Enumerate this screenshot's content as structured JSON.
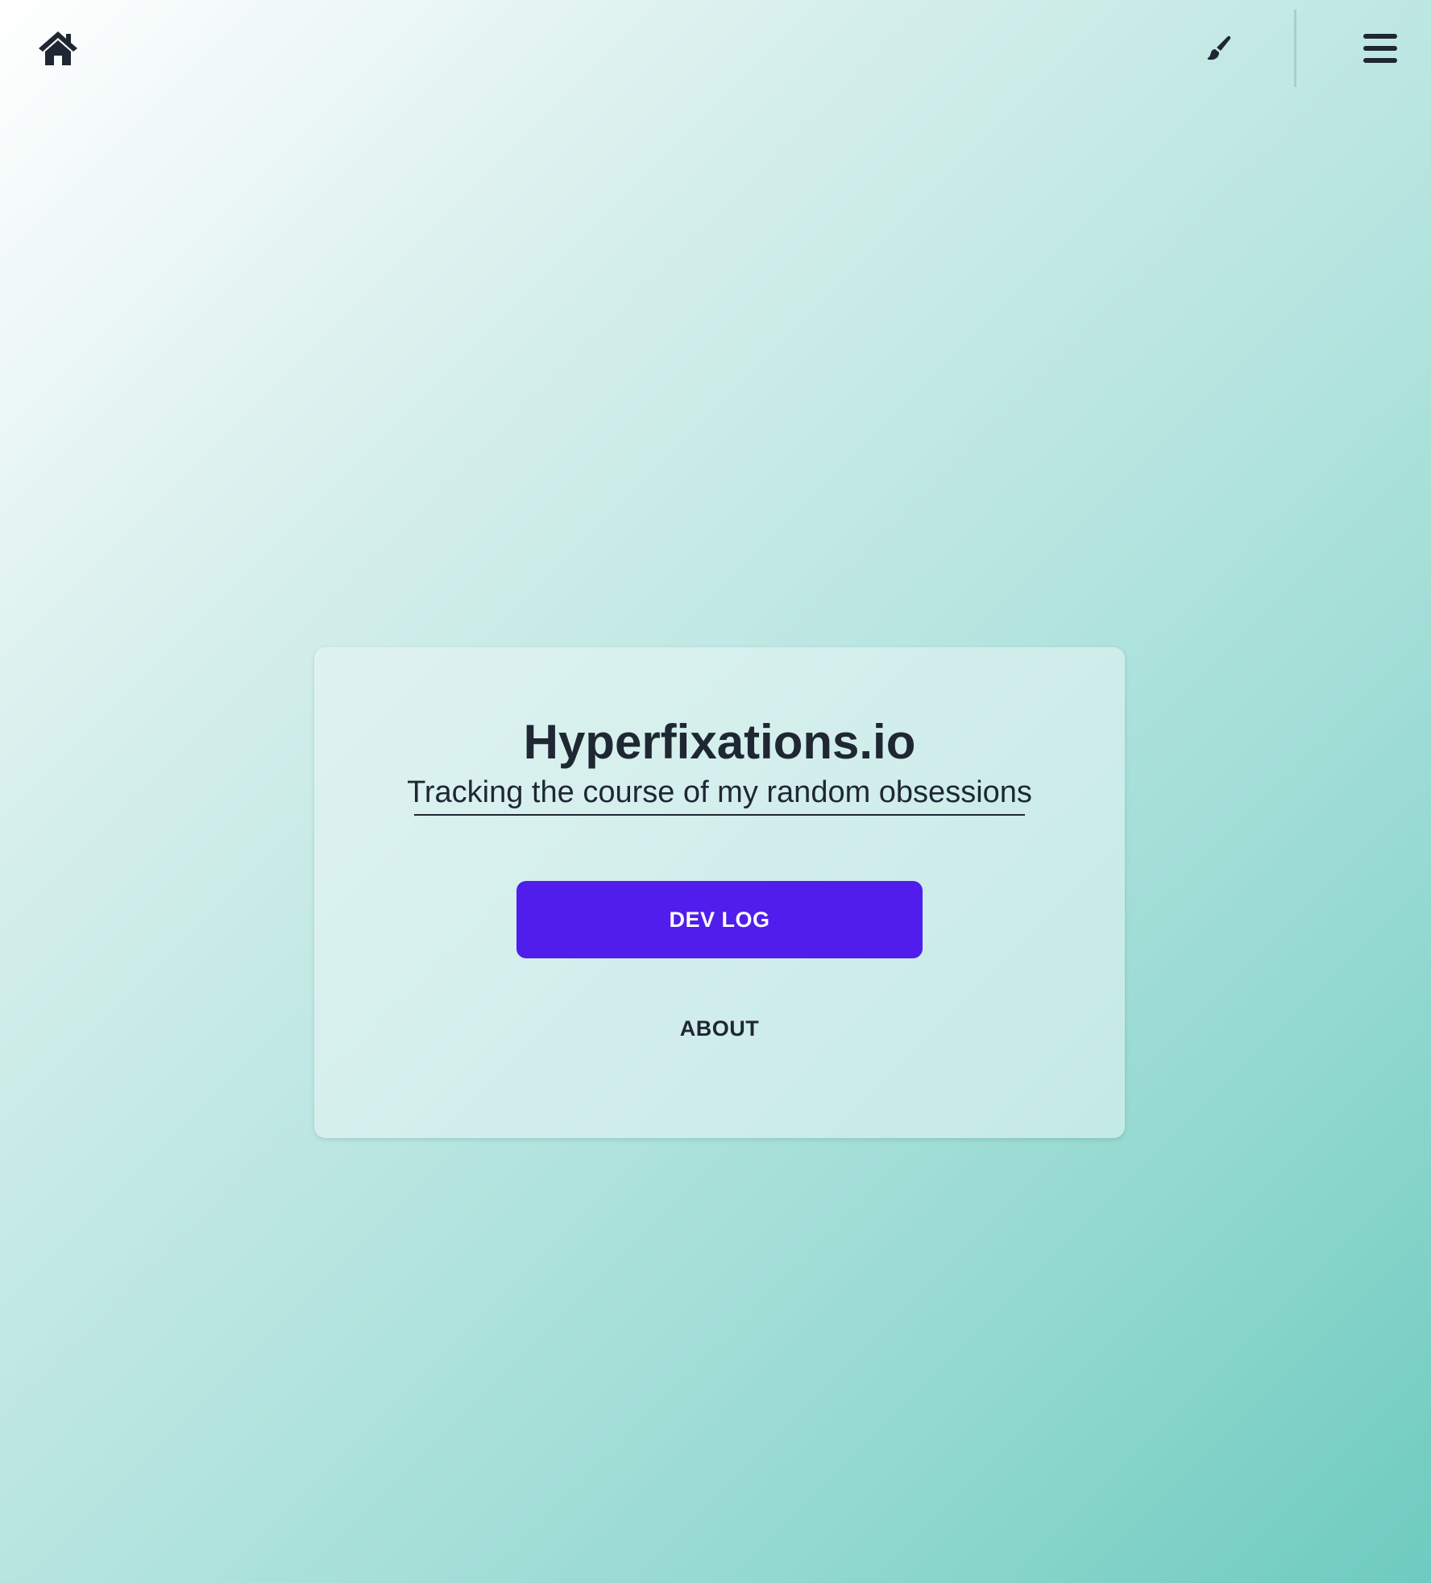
{
  "header": {
    "home_icon": "home-icon",
    "theme_icon": "paintbrush-icon",
    "menu_icon": "hamburger-menu-icon"
  },
  "hero": {
    "title": "Hyperfixations.io",
    "subtitle": "Tracking the course of my random obsessions",
    "primary_button_label": "DEV LOG",
    "secondary_button_label": "ABOUT"
  },
  "colors": {
    "primary": "#501ded",
    "text": "#1f2733",
    "background_start": "#ffffff",
    "background_end": "#6ecbbf"
  }
}
